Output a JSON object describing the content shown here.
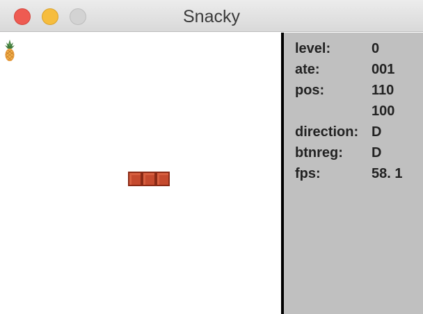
{
  "window": {
    "title": "Snacky",
    "controls": [
      "close",
      "minimize",
      "zoom"
    ]
  },
  "game": {
    "food_icon": "pineapple-icon",
    "snake": {
      "segments": 3,
      "color": "#c54a2e"
    }
  },
  "stats": {
    "level_label": "level:",
    "level_value": "0",
    "ate_label": "ate:",
    "ate_value": "001",
    "pos_label": "pos:",
    "pos_x": "110",
    "pos_y": "100",
    "direction_label": "direction:",
    "direction_value": "D",
    "btnreg_label": "btnreg:",
    "btnreg_value": "D",
    "fps_label": "fps:",
    "fps_value": "58. 1"
  },
  "colors": {
    "sidebar_bg": "#c0c0c0",
    "close": "#ee5b52",
    "minimize": "#f6bd3e",
    "zoom": "#d3d3d3"
  }
}
